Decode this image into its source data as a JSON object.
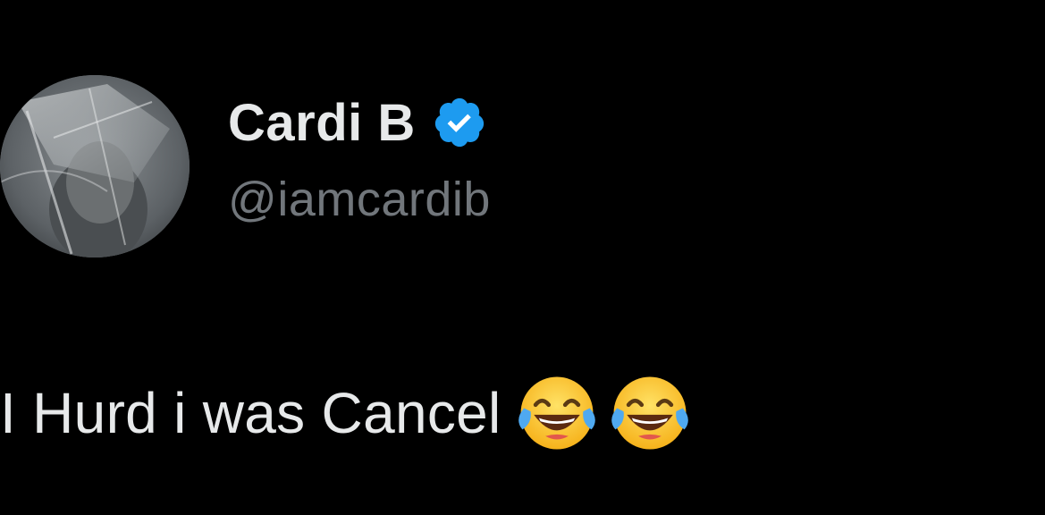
{
  "tweet": {
    "author": {
      "display_name": "Cardi B",
      "handle": "@iamcardib",
      "verified_icon": "verified-badge-icon",
      "avatar_icon": "profile-photo"
    },
    "text": "I Hurd i was Cancel",
    "emojis": [
      "face-with-tears-of-joy-icon",
      "face-with-tears-of-joy-icon"
    ]
  },
  "colors": {
    "background": "#000000",
    "primary_text": "#e7e9ea",
    "secondary_text": "#71767b",
    "verified_blue": "#1d9bf0"
  }
}
